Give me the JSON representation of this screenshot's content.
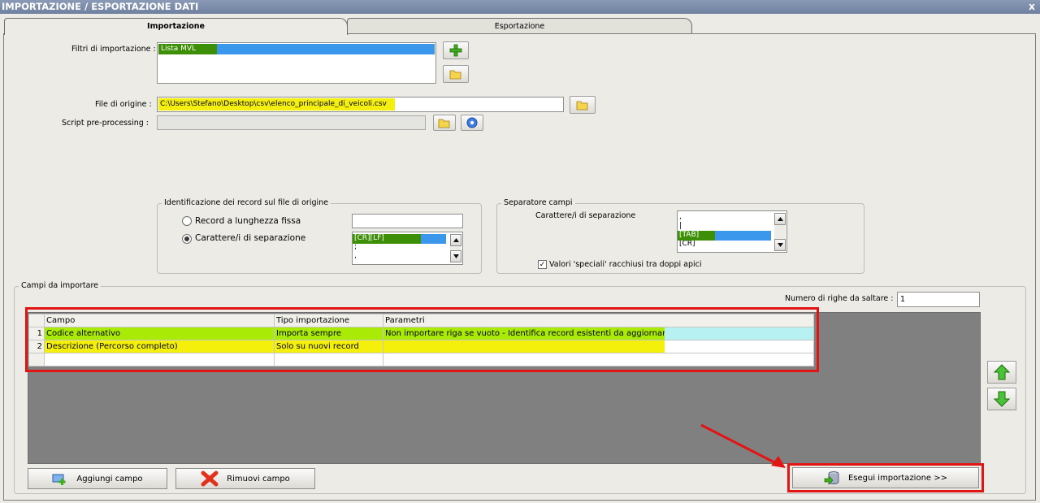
{
  "window": {
    "title": "IMPORTAZIONE / ESPORTAZIONE DATI",
    "close_label": "x"
  },
  "tabs": [
    {
      "label": "Importazione",
      "active": true
    },
    {
      "label": "Esportazione",
      "active": false
    }
  ],
  "filters": {
    "label": "Filtri di importazione :",
    "items": [
      {
        "label": "Lista MVL",
        "selected": true
      }
    ]
  },
  "source_file": {
    "label": "File di origine :",
    "value": "C:\\Users\\Stefano\\Desktop\\csv\\elenco_principale_di_veicoli.csv"
  },
  "script": {
    "label": "Script pre-processing :",
    "value": ""
  },
  "record_group": {
    "title": "Identificazione dei record sul file di origine",
    "radio_fixed": {
      "label": "Record a lunghezza fissa",
      "checked": false
    },
    "radio_separator": {
      "label": "Carattere/i di separazione",
      "checked": true
    },
    "fixed_value": "",
    "separator_options": [
      "[CR][LF]",
      ";",
      ","
    ],
    "selected_index": 0
  },
  "field_separator_group": {
    "title": "Separatore campi",
    "label": "Carattere/i di separazione",
    "options": [
      ",",
      "|",
      "[TAB]",
      "[CR]"
    ],
    "selected_index": 2,
    "quoted_checkbox": {
      "label": "Valori 'speciali' racchiusi tra doppi apici",
      "checked": true
    }
  },
  "fields_group": {
    "title": "Campi da importare",
    "skip_rows_label": "Numero di righe da saltare :",
    "skip_rows_value": "1",
    "columns": [
      "Campo",
      "Tipo importazione",
      "Parametri"
    ],
    "rows": [
      {
        "num": "1",
        "campo": "Codice alternativo",
        "tipo": "Importa sempre",
        "parametri": "Non importare riga se vuoto - Identifica record esistenti da aggiornare"
      },
      {
        "num": "2",
        "campo": "Descrizione (Percorso completo)",
        "tipo": "Solo su nuovi record",
        "parametri": ""
      }
    ]
  },
  "buttons": {
    "add_field": "Aggiungi campo",
    "remove_field": "Rimuovi campo",
    "run_import": "Esegui importazione >>"
  },
  "colors": {
    "highlight_red": "#e21414",
    "selection_green": "#3d8f07",
    "selection_yellow": "#f4ef11",
    "selection_blue": "#3b97ec"
  }
}
